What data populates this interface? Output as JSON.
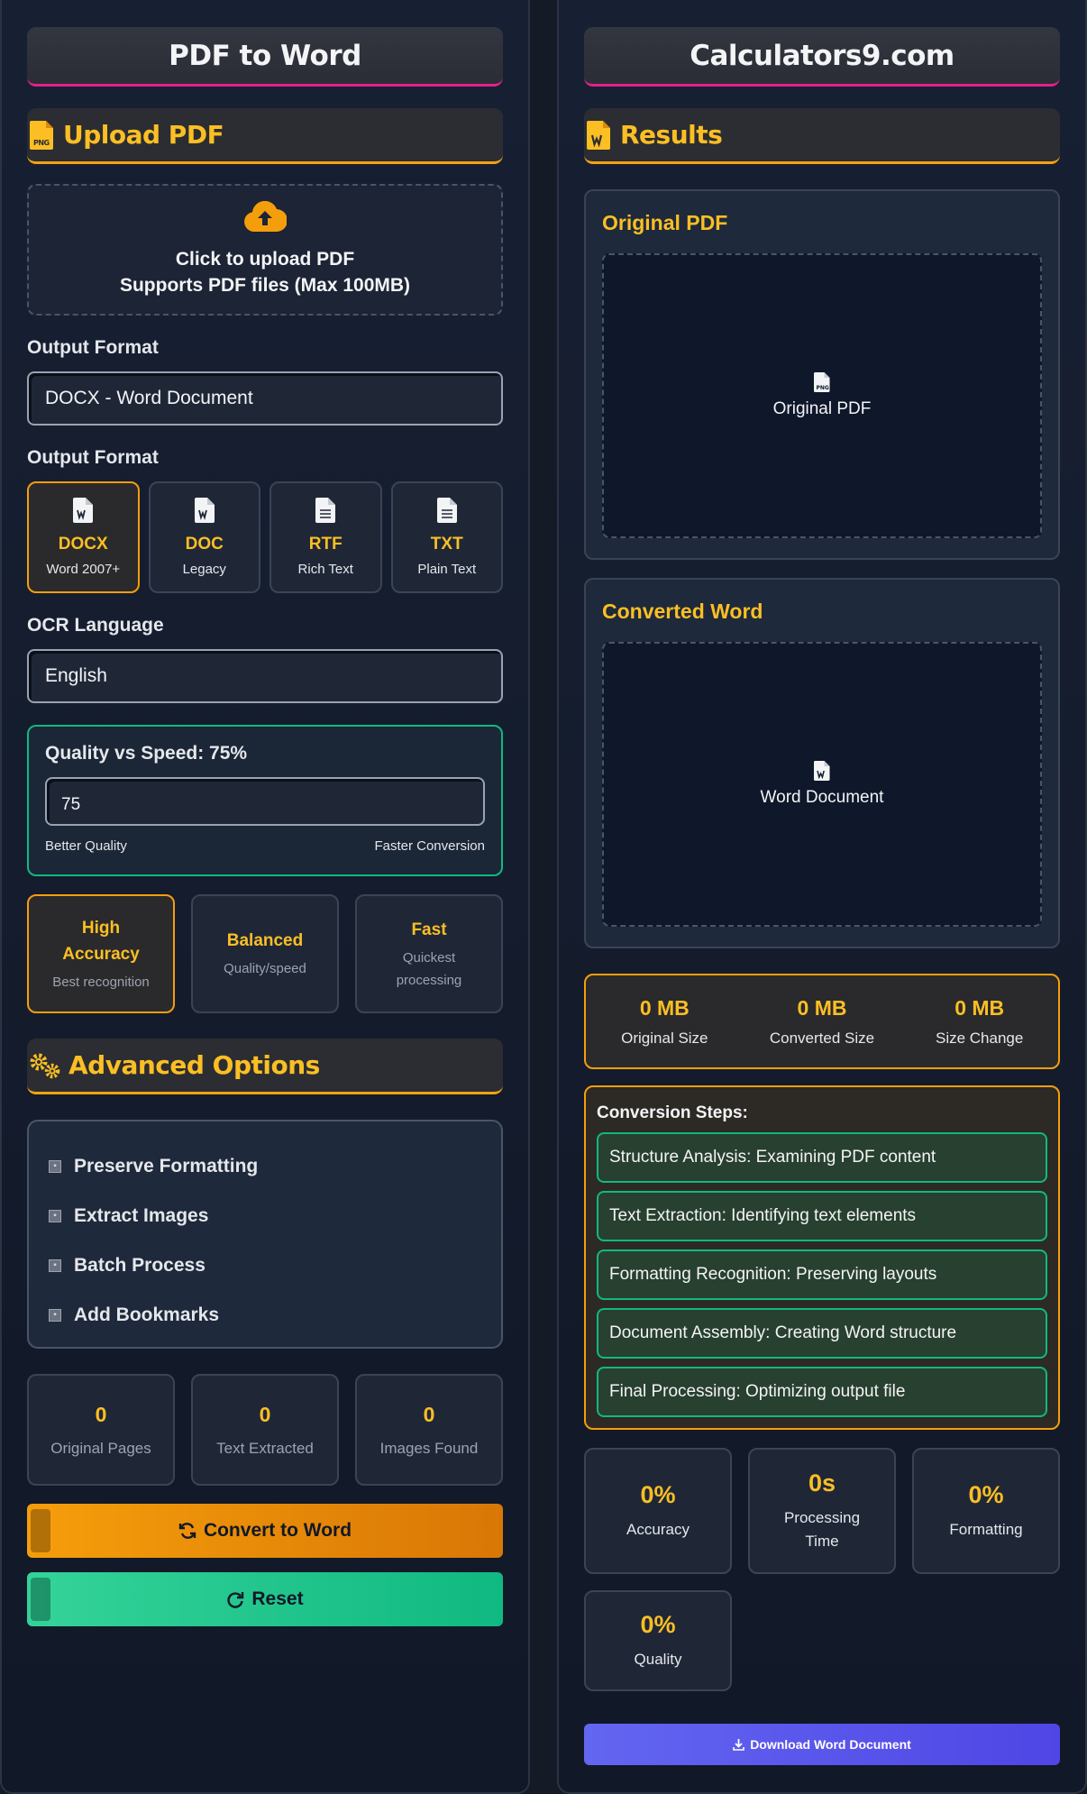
{
  "left": {
    "title": "PDF to Word",
    "upload_section": {
      "title": "Upload PDF",
      "icon": "file-pdf-icon"
    },
    "upload": {
      "line1": "Click to upload PDF",
      "line2": "Supports PDF files (Max 100MB)",
      "icon": "cloud-upload-icon"
    },
    "output_format": {
      "label": "Output Format",
      "selected": "DOCX - Word Document"
    },
    "format_cards": {
      "label": "Output Format",
      "items": [
        {
          "code": "DOCX",
          "desc": "Word 2007+",
          "active": true
        },
        {
          "code": "DOC",
          "desc": "Legacy",
          "active": false
        },
        {
          "code": "RTF",
          "desc": "Rich Text",
          "active": false
        },
        {
          "code": "TXT",
          "desc": "Plain Text",
          "active": false
        }
      ]
    },
    "ocr": {
      "label": "OCR Language",
      "selected": "English"
    },
    "quality": {
      "title": "Quality vs Speed: 75%",
      "value": "75",
      "low_label": "Better Quality",
      "high_label": "Faster Conversion"
    },
    "modes": [
      {
        "title": "High Accuracy",
        "desc": "Best recognition",
        "active": true
      },
      {
        "title": "Balanced",
        "desc": "Quality/speed",
        "active": false
      },
      {
        "title": "Fast",
        "desc": "Quickest processing",
        "active": false
      }
    ],
    "advanced": {
      "title": "Advanced Options",
      "icon": "gears-icon"
    },
    "options": [
      "Preserve Formatting",
      "Extract Images",
      "Batch Process",
      "Add Bookmarks"
    ],
    "stats": [
      {
        "value": "0",
        "label": "Original Pages"
      },
      {
        "value": "0",
        "label": "Text Extracted"
      },
      {
        "value": "0",
        "label": "Images Found"
      }
    ],
    "convert_label": "Convert to Word",
    "reset_label": "Reset"
  },
  "right": {
    "title": "Calculators9.com",
    "results_section": {
      "title": "Results",
      "icon": "file-word-icon"
    },
    "original_preview": {
      "title": "Original PDF",
      "placeholder": "Original PDF"
    },
    "converted_preview": {
      "title": "Converted Word",
      "placeholder": "Word Document"
    },
    "sizes": [
      {
        "value": "0 MB",
        "label": "Original Size"
      },
      {
        "value": "0 MB",
        "label": "Converted Size"
      },
      {
        "value": "0 MB",
        "label": "Size Change"
      }
    ],
    "steps": {
      "title": "Conversion Steps:",
      "items": [
        "Structure Analysis: Examining PDF content",
        "Text Extraction: Identifying text elements",
        "Formatting Recognition: Preserving layouts",
        "Document Assembly: Creating Word structure",
        "Final Processing: Optimizing output file"
      ]
    },
    "metrics": [
      {
        "value": "0%",
        "label": "Accuracy"
      },
      {
        "value": "0s",
        "label": "Processing Time"
      },
      {
        "value": "0%",
        "label": "Formatting"
      },
      {
        "value": "0%",
        "label": "Quality"
      }
    ],
    "download_label": "Download Word Document"
  },
  "colors": {
    "accent": "#fbbf24",
    "orange": "#f59e0b",
    "green": "#10b981",
    "pink": "#e61f8c",
    "indigo": "#6366f1"
  }
}
